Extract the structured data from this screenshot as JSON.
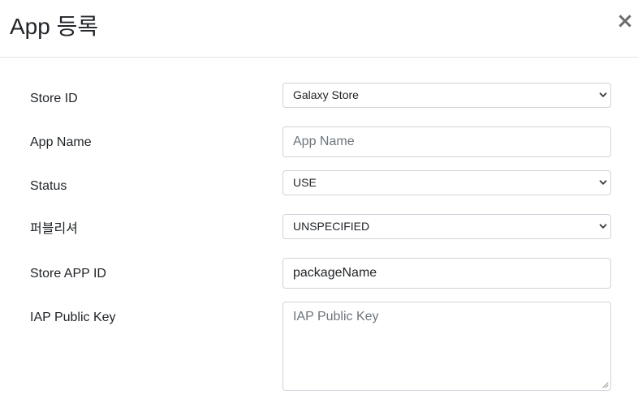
{
  "modal": {
    "title": "App 등록",
    "close_label": "×"
  },
  "form": {
    "store_id": {
      "label": "Store ID",
      "value": "Galaxy Store"
    },
    "app_name": {
      "label": "App Name",
      "placeholder": "App Name",
      "value": ""
    },
    "status": {
      "label": "Status",
      "value": "USE"
    },
    "publisher": {
      "label": "퍼블리셔",
      "value": "UNSPECIFIED"
    },
    "store_app_id": {
      "label": "Store APP ID",
      "value": "packageName"
    },
    "iap_public_key": {
      "label": "IAP Public Key",
      "placeholder": "IAP Public Key",
      "value": ""
    }
  },
  "icons": {
    "close": "close-icon",
    "select_arrow": "chevron-down-icon",
    "resize": "resize-grip-icon"
  }
}
